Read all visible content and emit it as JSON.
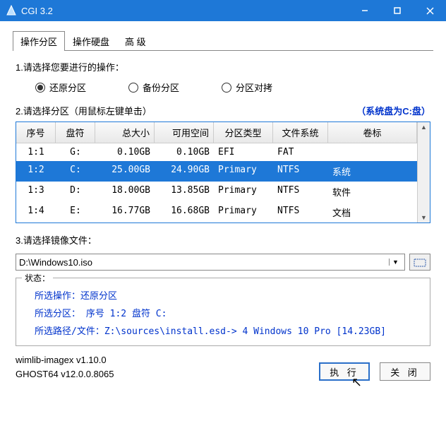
{
  "window": {
    "title": "CGI 3.2"
  },
  "tabs": {
    "t0": "操作分区",
    "t1": "操作硬盘",
    "t2": "高 级"
  },
  "step1": {
    "label": "1.请选择您要进行的操作：",
    "opt_restore": "还原分区",
    "opt_backup": "备份分区",
    "opt_clone": "分区对拷"
  },
  "step2": {
    "label": "2.请选择分区（用鼠标左键单击）",
    "sysdisk": "（系统盘为C:盘）",
    "headers": {
      "c0": "序号",
      "c1": "盘符",
      "c2": "总大小",
      "c3": "可用空间",
      "c4": "分区类型",
      "c5": "文件系统",
      "c6": "卷标"
    },
    "rows": [
      {
        "c0": "1:1",
        "c1": "G:",
        "c2": "0.10GB",
        "c3": "0.10GB",
        "c4": "EFI",
        "c5": "FAT",
        "c6": ""
      },
      {
        "c0": "1:2",
        "c1": "C:",
        "c2": "25.00GB",
        "c3": "24.90GB",
        "c4": "Primary",
        "c5": "NTFS",
        "c6": "系统"
      },
      {
        "c0": "1:3",
        "c1": "D:",
        "c2": "18.00GB",
        "c3": "13.85GB",
        "c4": "Primary",
        "c5": "NTFS",
        "c6": "软件"
      },
      {
        "c0": "1:4",
        "c1": "E:",
        "c2": "16.77GB",
        "c3": "16.68GB",
        "c4": "Primary",
        "c5": "NTFS",
        "c6": "文档"
      }
    ]
  },
  "step3": {
    "label": "3.请选择镜像文件：",
    "value": "D:\\Windows10.iso"
  },
  "status": {
    "title": "状态：",
    "line1": "所选操作：还原分区",
    "line2": "所选分区：  序号 1:2        盘符 C:",
    "line3": "所选路径/文件：Z:\\sources\\install.esd-> 4  Windows 10 Pro [14.23GB]"
  },
  "footer": {
    "v1": "wimlib-imagex v1.10.0",
    "v2": "GHOST64 v12.0.0.8065",
    "btn_exec": "执 行",
    "btn_close": "关 闭"
  }
}
